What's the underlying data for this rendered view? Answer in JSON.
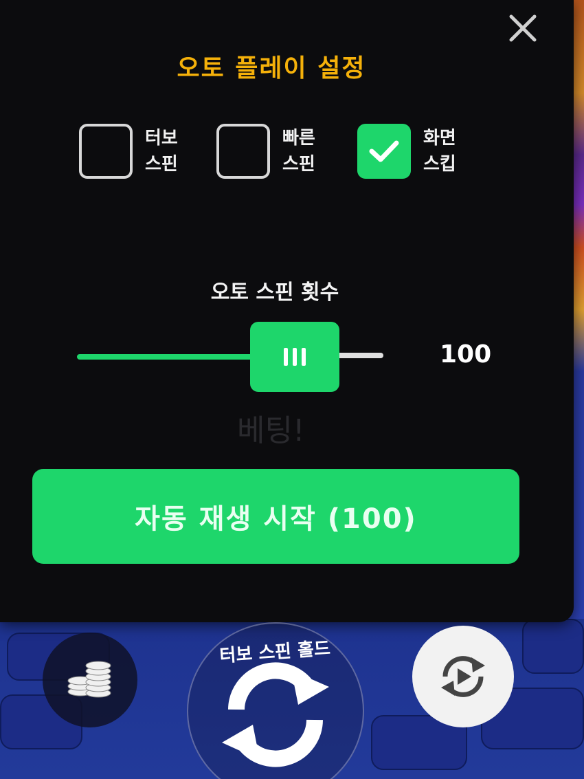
{
  "panel": {
    "title": "오토 플레이 설정",
    "options": [
      {
        "label_line1": "터보",
        "label_line2": "스핀",
        "checked": false
      },
      {
        "label_line1": "빠른",
        "label_line2": "스핀",
        "checked": false
      },
      {
        "label_line1": "화면",
        "label_line2": "스킵",
        "checked": true
      }
    ],
    "slider": {
      "title": "오토 스핀 횟수",
      "value": "100"
    },
    "background_text": "베팅!",
    "start_button_label": "자동 재생 시작 (100)"
  },
  "controls": {
    "spin_hold_label": "터보 스핀 홀드"
  },
  "colors": {
    "accent_green": "#1ed66b",
    "title_orange": "#f5b10a",
    "panel_bg": "#0c0c0e"
  }
}
